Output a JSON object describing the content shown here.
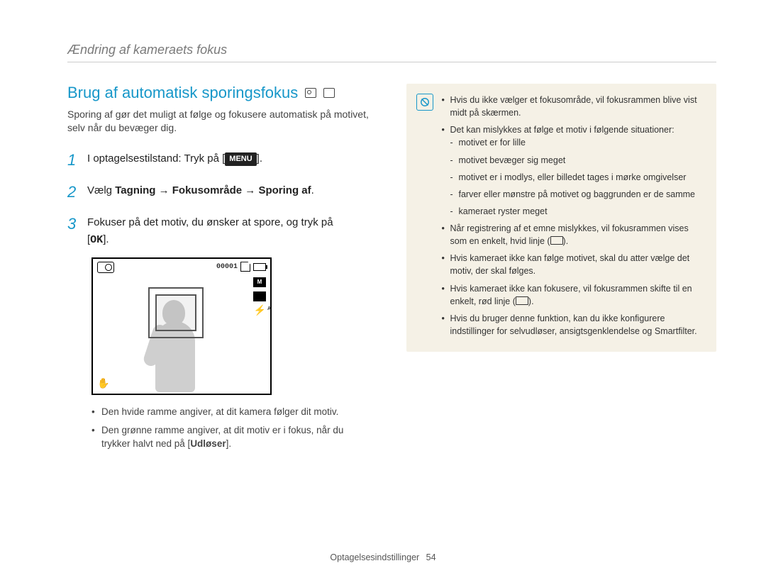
{
  "header": {
    "running_head": "Ændring af kameraets fokus"
  },
  "section": {
    "title": "Brug af automatisk sporingsfokus",
    "intro": "Sporing af gør det muligt at følge og fokusere automatisk på motivet, selv når du bevæger dig."
  },
  "steps": {
    "s1_prefix": "I optagelsestilstand: Tryk på [",
    "s1_btn": "MENU",
    "s1_suffix": "].",
    "s2_prefix": "Vælg ",
    "s2_path1": "Tagning",
    "s2_arrow": " → ",
    "s2_path2": "Fokusområde",
    "s2_path3": "Sporing af",
    "s2_suffix": ".",
    "s3_line1": "Fokuser på det motiv, du ønsker at spore, og tryk på",
    "s3_btn": "OK",
    "s3_prefix": "[",
    "s3_suffix": "]."
  },
  "lcd": {
    "counter": "00001",
    "size_label": "M",
    "flash_glyph": "⚡"
  },
  "subnotes": {
    "n1_prefix": "Den hvide ramme angiver, at dit kamera følger dit motiv.",
    "n2_line1": "Den grønne ramme angiver, at dit motiv er i fokus, når du",
    "n2_line2_prefix": "trykker halvt ned på [",
    "n2_btn": "Udløser",
    "n2_line2_suffix": "]."
  },
  "infobox": {
    "b1": "Hvis du ikke vælger et fokusområde, vil fokusrammen blive vist midt på skærmen.",
    "b2": "Det kan mislykkes at følge et motiv i følgende situationer:",
    "b2a": "motivet er for lille",
    "b2b": "motivet bevæger sig meget",
    "b2c": "motivet er i modlys, eller billedet tages i mørke omgivelser",
    "b2d": "farver eller mønstre på motivet og baggrunden er de samme",
    "b2e": "kameraet ryster meget",
    "b3a": "Når registrering af et emne mislykkes, vil fokusrammen vises som en enkelt, hvid linje (",
    "b3b": ").",
    "b4": "Hvis kameraet ikke kan følge motivet, skal du atter vælge det motiv, der skal følges.",
    "b5a": "Hvis kameraet ikke kan fokusere, vil fokusrammen skifte til en enkelt, rød linje (",
    "b5b": ").",
    "b6": "Hvis du bruger denne funktion, kan du ikke konfigurere indstillinger for selvudløser, ansigtsgenklendelse og Smartfilter."
  },
  "footer": {
    "section": "Optagelsesindstillinger",
    "page": "54"
  }
}
